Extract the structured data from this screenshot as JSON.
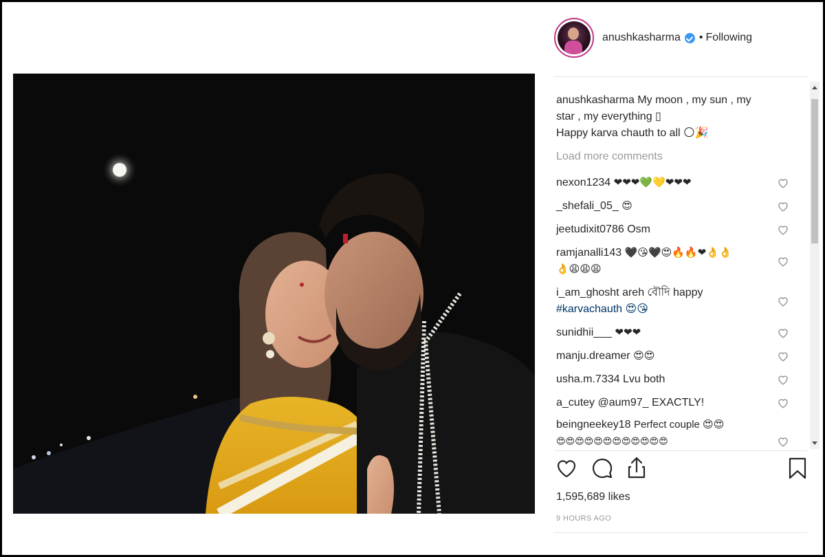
{
  "post": {
    "username": "anushkasharma",
    "follow_sep": "•",
    "follow_status": "Following",
    "caption_user": "anushkasharma",
    "caption_line1": "My moon , my sun , my",
    "caption_line2": "star , my everything ▯",
    "caption_line3": "Happy karva chauth to all 🌕🎉",
    "load_more": "Load more comments",
    "likes": "1,595,689 likes",
    "time": "9 HOURS AGO"
  },
  "comments": [
    {
      "user": "nexon1234",
      "text": "❤❤❤💚💛❤❤❤"
    },
    {
      "user": "_shefali_05_",
      "text": "😍"
    },
    {
      "user": "jeetudixit0786",
      "text": "Osm"
    },
    {
      "user": "ramjanalli143",
      "text": "🖤😘🖤😍🔥🔥❤👌👌"
    },
    {
      "user": "",
      "text": "👌😩😩😩"
    },
    {
      "user": "i_am_ghosht",
      "text": "areh বৌদি happy"
    },
    {
      "user": "",
      "text": "#karvachauth 😍😘"
    },
    {
      "user": "sunidhii___",
      "text": "❤❤❤"
    },
    {
      "user": "manju.dreamer",
      "text": "😍😍"
    },
    {
      "user": "usha.m.7334",
      "text": "Lvu both"
    },
    {
      "user": "a_cutey",
      "text": "@aum97_ EXACTLY!"
    },
    {
      "user": "beingneekey18",
      "text": "Perfect couple 😍😍"
    },
    {
      "user": "",
      "text": "😍😍😍😍😍😍😍😍😍😍😍😍"
    }
  ],
  "icons": {
    "like": "heart-icon",
    "comment": "comment-icon",
    "share": "share-icon",
    "save": "bookmark-icon",
    "verified": "verified-badge-icon"
  },
  "colors": {
    "verified": "#3897f0",
    "avatar_ring": "#c13584",
    "muted_text": "#999999"
  }
}
